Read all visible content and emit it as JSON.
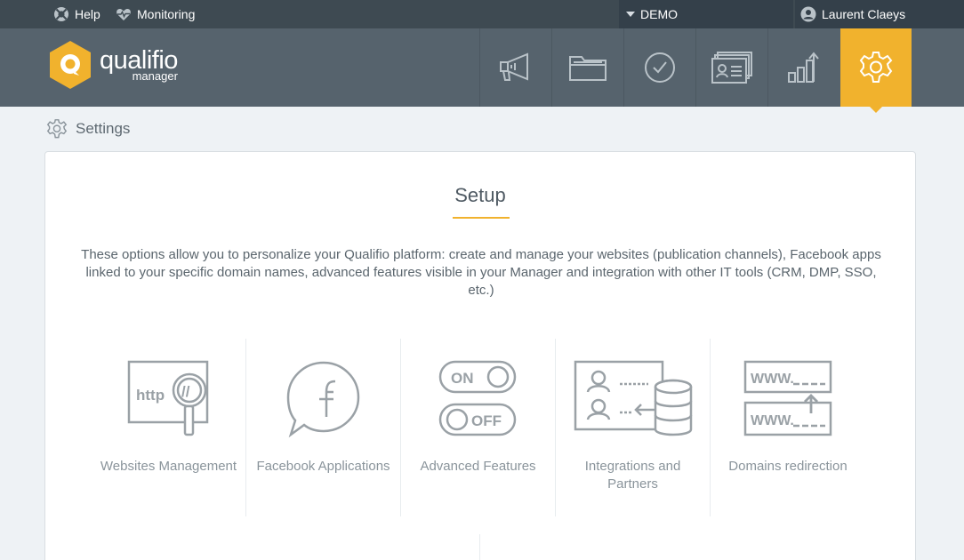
{
  "topbar": {
    "help_label": "Help",
    "monitoring_label": "Monitoring",
    "workspace_label": "DEMO",
    "user_name": "Laurent Claeys"
  },
  "brand": {
    "name": "qualifio",
    "tagline": "manager",
    "logo_color": "#f1b22d"
  },
  "nav": {
    "items": [
      {
        "icon": "megaphone-icon"
      },
      {
        "icon": "folder-icon"
      },
      {
        "icon": "check-circle-icon"
      },
      {
        "icon": "contacts-icon"
      },
      {
        "icon": "bar-chart-icon"
      },
      {
        "icon": "gear-icon",
        "active": true
      }
    ],
    "accent": "#f1b22d"
  },
  "breadcrumb": {
    "label": "Settings"
  },
  "setup": {
    "title": "Setup",
    "description": "These options allow you to personalize your Qualifio platform: create and manage your websites (publication channels), Facebook apps linked to your specific domain names, advanced features visible in your Manager and integration with other IT tools (CRM, DMP, SSO, etc.)",
    "features": [
      {
        "label": "Websites Management",
        "icon": "http-magnifier-icon"
      },
      {
        "label": "Facebook Applications",
        "icon": "facebook-bubble-icon"
      },
      {
        "label": "Advanced Features",
        "icon": "on-off-toggle-icon"
      },
      {
        "label": "Integrations and Partners",
        "icon": "integration-database-icon"
      },
      {
        "label": "Domains redirection",
        "icon": "www-redirect-icon"
      }
    ]
  }
}
